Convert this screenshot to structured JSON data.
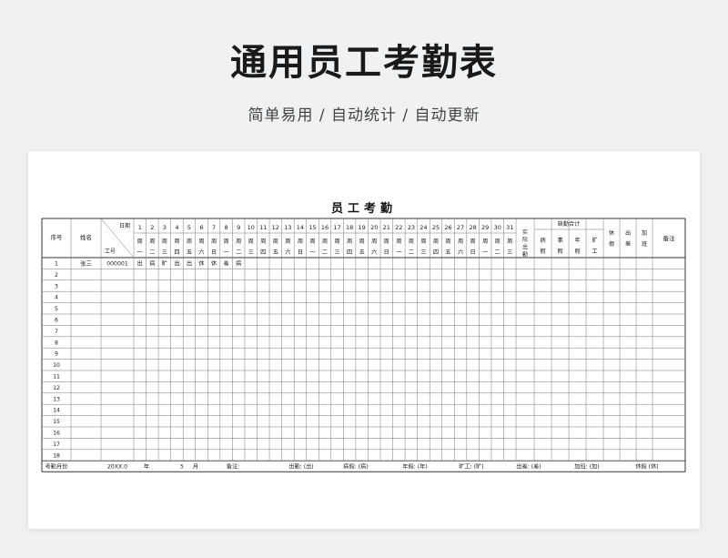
{
  "hero": {
    "title": "通用员工考勤表",
    "subtitle": "简单易用 / 自动统计 / 自动更新"
  },
  "sheet": {
    "title": "员工考勤",
    "header": {
      "seq": "序号",
      "name": "姓名",
      "date": "日期",
      "empno": "工号",
      "actual": [
        "实",
        "际",
        "出",
        "勤"
      ],
      "absence_group": "缺勤合计",
      "absence": [
        [
          "病",
          "假"
        ],
        [
          "事",
          "假"
        ],
        [
          "年",
          "假"
        ],
        [
          "旷",
          "工"
        ]
      ],
      "rest": [
        "休",
        "假"
      ],
      "trip": [
        "出",
        "差"
      ],
      "overtime": [
        "加",
        "班"
      ],
      "remark": "备注"
    },
    "days": [
      "1",
      "2",
      "3",
      "4",
      "5",
      "6",
      "7",
      "8",
      "9",
      "10",
      "11",
      "12",
      "13",
      "14",
      "15",
      "16",
      "17",
      "18",
      "19",
      "20",
      "21",
      "22",
      "23",
      "24",
      "25",
      "26",
      "27",
      "28",
      "29",
      "30",
      "31"
    ],
    "weekdays": [
      [
        "周",
        "一"
      ],
      [
        "周",
        "二"
      ],
      [
        "周",
        "三"
      ],
      [
        "周",
        "四"
      ],
      [
        "周",
        "五"
      ],
      [
        "周",
        "六"
      ],
      [
        "周",
        "日"
      ],
      [
        "周",
        "一"
      ],
      [
        "周",
        "二"
      ],
      [
        "周",
        "三"
      ],
      [
        "周",
        "四"
      ],
      [
        "周",
        "五"
      ],
      [
        "周",
        "六"
      ],
      [
        "周",
        "日"
      ],
      [
        "周",
        "一"
      ],
      [
        "周",
        "二"
      ],
      [
        "周",
        "三"
      ],
      [
        "周",
        "四"
      ],
      [
        "周",
        "五"
      ],
      [
        "周",
        "六"
      ],
      [
        "周",
        "日"
      ],
      [
        "周",
        "一"
      ],
      [
        "周",
        "二"
      ],
      [
        "周",
        "三"
      ],
      [
        "周",
        "四"
      ],
      [
        "周",
        "五"
      ],
      [
        "周",
        "六"
      ],
      [
        "周",
        "日"
      ],
      [
        "周",
        "一"
      ],
      [
        "周",
        "二"
      ],
      [
        "周",
        "三"
      ]
    ],
    "rows": [
      {
        "seq": "1",
        "name": "张三",
        "empno": "000001",
        "marks": [
          "出",
          "病",
          "旷",
          "出",
          "出",
          "休",
          "休",
          "差",
          "病"
        ]
      },
      {
        "seq": "2"
      },
      {
        "seq": "3"
      },
      {
        "seq": "4"
      },
      {
        "seq": "5"
      },
      {
        "seq": "6"
      },
      {
        "seq": "7"
      },
      {
        "seq": "8"
      },
      {
        "seq": "9"
      },
      {
        "seq": "10"
      },
      {
        "seq": "11"
      },
      {
        "seq": "12"
      },
      {
        "seq": "13"
      },
      {
        "seq": "14"
      },
      {
        "seq": "15"
      },
      {
        "seq": "16"
      },
      {
        "seq": "17"
      },
      {
        "seq": "18"
      }
    ],
    "footer": {
      "month_label": "考勤月份",
      "year_value": "20XX.0",
      "year_unit": "年",
      "month_value": "5",
      "month_unit": "月",
      "remark_label": "备注:",
      "legend": [
        "出勤: (出)",
        "病假: (病)",
        "年假: (年)",
        "旷工: (旷)",
        "出差: (差)",
        "加班: (加)",
        "休假 (休)"
      ]
    }
  }
}
